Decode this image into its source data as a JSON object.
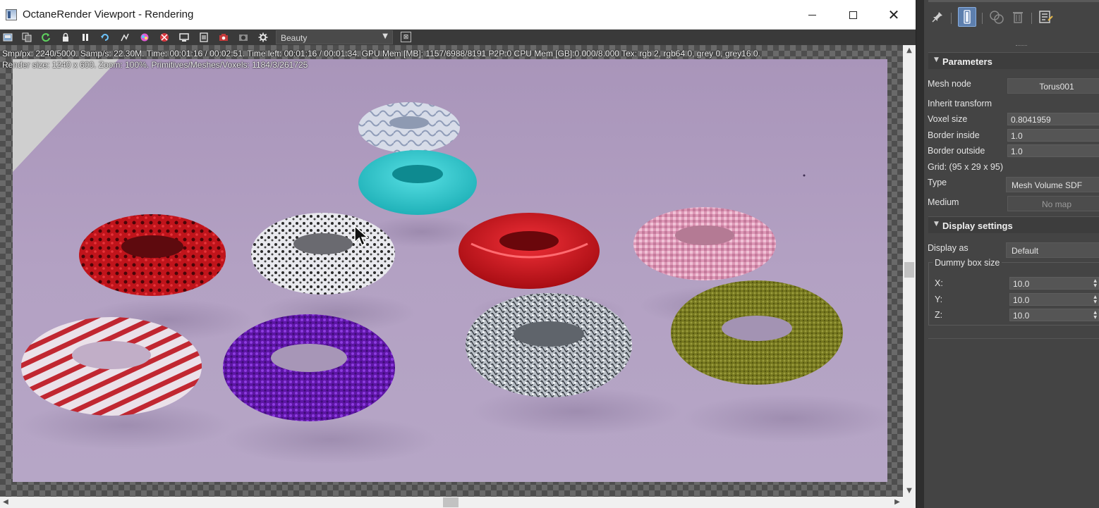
{
  "window": {
    "title": "OctaneRender Viewport - Rendering"
  },
  "toolbar": {
    "icons": [
      "save-icon",
      "copy-icon",
      "refresh-icon",
      "lock-icon",
      "pause-icon",
      "restart-icon",
      "region-icon",
      "color-picker-icon",
      "clay-mode-icon",
      "display-icon",
      "film-icon",
      "camera-icon",
      "snapshot-icon",
      "settings-gear-icon"
    ],
    "pass_selected": "Beauty"
  },
  "stats": {
    "line1": "Smp/px: 2240/5000.   Samp/s: 22.30M.   Time: 00:01:16 / 00:02:51.   Time left: 00:01:16 / 00:01:34.   GPU Mem [MB]: 1157/6988/8191 P2P:0   CPU Mem [GB]:0.000/8.000   Tex: rgb 2, rgb64 0, grey 0, grey16 0.",
    "line2": "Render size: 1240 x 600.   Zoom: 100%.   Primitives/Meshes/Voxels: 1184/3/261725"
  },
  "scene": {
    "background_color": "#b19fbf",
    "toruses": [
      {
        "name": "patterned-torus",
        "color": "#c7cfe0"
      },
      {
        "name": "cyan-torus",
        "color": "#2ec9cf"
      },
      {
        "name": "red-splotch-torus",
        "color": "#c0141b"
      },
      {
        "name": "white-speckled-torus",
        "color": "#e6e6ea"
      },
      {
        "name": "red-carved-torus",
        "color": "#d6141c"
      },
      {
        "name": "pink-voxel-torus",
        "color": "#e3a2bd"
      },
      {
        "name": "red-striped-torus",
        "color": "#c31a22"
      },
      {
        "name": "purple-leafy-torus",
        "color": "#6a1fb5"
      },
      {
        "name": "metal-shard-torus",
        "color": "#c8ccd2"
      },
      {
        "name": "olive-moss-torus",
        "color": "#7b7d25"
      }
    ]
  },
  "panel": {
    "parameters": {
      "title": "Parameters",
      "mesh_node_label": "Mesh node",
      "mesh_node_value": "Torus001",
      "inherit_transform_label": "Inherit transform",
      "voxel_size_label": "Voxel size",
      "voxel_size_value": "0.8041959",
      "border_inside_label": "Border inside",
      "border_inside_value": "1.0",
      "border_outside_label": "Border outside",
      "border_outside_value": "1.0",
      "grid_text": "Grid: (95 x 29 x 95)",
      "type_label": "Type",
      "type_value": "Mesh Volume SDF",
      "medium_label": "Medium",
      "medium_value": "No map"
    },
    "display": {
      "title": "Display settings",
      "display_as_label": "Display as",
      "display_as_value": "Default",
      "dummy_box_title": "Dummy box size",
      "x_label": "X:",
      "x_value": "10.0",
      "y_label": "Y:",
      "y_value": "10.0",
      "z_label": "Z:",
      "z_value": "10.0"
    }
  }
}
